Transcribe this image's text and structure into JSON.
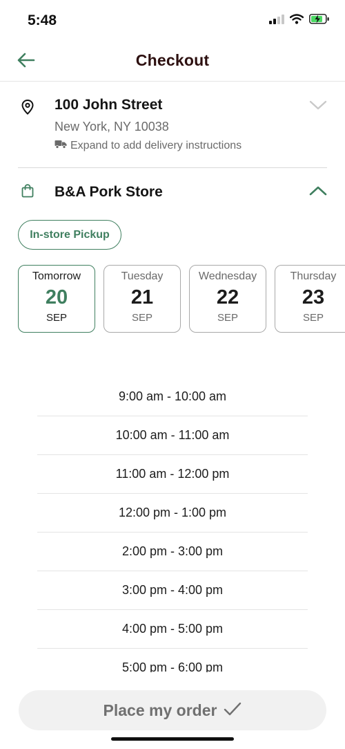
{
  "status_bar": {
    "time": "5:48"
  },
  "header": {
    "title": "Checkout"
  },
  "address": {
    "street": "100 John Street",
    "city": "New York, NY 10038",
    "instructions": "Expand to add delivery instructions"
  },
  "store": {
    "name": "B&A Pork Store"
  },
  "fulfillment": {
    "chip_label": "In-store Pickup"
  },
  "dates": [
    {
      "day": "Tomorrow",
      "num": "20",
      "month": "SEP",
      "selected": true
    },
    {
      "day": "Tuesday",
      "num": "21",
      "month": "SEP",
      "selected": false
    },
    {
      "day": "Wednesday",
      "num": "22",
      "month": "SEP",
      "selected": false
    },
    {
      "day": "Thursday",
      "num": "23",
      "month": "SEP",
      "selected": false
    }
  ],
  "time_slots": [
    "9:00 am - 10:00 am",
    "10:00 am - 11:00 am",
    "11:00 am - 12:00 pm",
    "12:00 pm - 1:00 pm",
    "2:00 pm - 3:00 pm",
    "3:00 pm - 4:00 pm",
    "4:00 pm - 5:00 pm",
    "5:00 pm - 6:00 pm"
  ],
  "footer": {
    "place_order_label": "Place my order"
  },
  "colors": {
    "accent": "#3f7f5f",
    "title": "#2d1010",
    "muted": "#6a6a6a"
  }
}
